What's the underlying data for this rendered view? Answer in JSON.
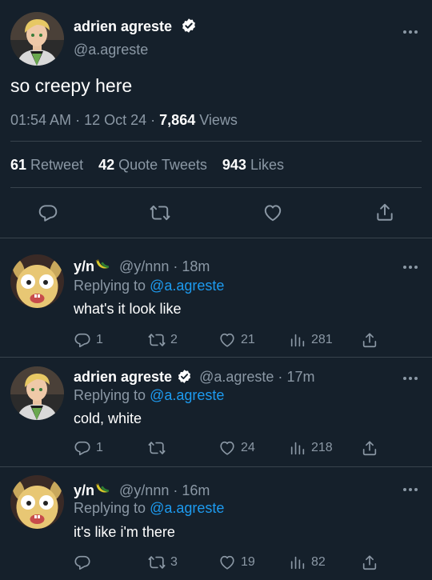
{
  "main_tweet": {
    "name": "adrien agreste",
    "handle": "@a.agreste",
    "text": "so creepy here",
    "time": "01:54 AM",
    "date": "12 Oct 24",
    "views_count": "7,864",
    "views_label": "Views",
    "retweets_count": "61",
    "retweets_label": "Retweet",
    "quotes_count": "42",
    "quotes_label": "Quote Tweets",
    "likes_count": "943",
    "likes_label": "Likes"
  },
  "replies": [
    {
      "name": "y/n",
      "handle": "@y/nnn",
      "age": "18m",
      "replying_prefix": "Replying to",
      "replying_to": "@a.agreste",
      "text": "what's it look like",
      "replies": "1",
      "retweets": "2",
      "likes": "21",
      "views": "281"
    },
    {
      "name": "adrien agreste",
      "handle": "@a.agreste",
      "age": "17m",
      "replying_prefix": "Replying to",
      "replying_to": "@a.agreste",
      "text": "cold, white",
      "replies": "1",
      "retweets": "",
      "likes": "24",
      "views": "218"
    },
    {
      "name": "y/n",
      "handle": "@y/nnn",
      "age": "16m",
      "replying_prefix": "Replying to",
      "replying_to": "@a.agreste",
      "text": "it's like i'm there",
      "replies": "",
      "retweets": "3",
      "likes": "19",
      "views": "82"
    }
  ],
  "separator": "·",
  "colors": {
    "background": "#15202b",
    "muted": "#8b98a5",
    "link": "#1d9bf0",
    "divider": "#38444d"
  },
  "icons": [
    "verified-icon",
    "more-icon",
    "reply-icon",
    "retweet-icon",
    "like-icon",
    "views-icon",
    "share-icon",
    "banana-emoji-icon"
  ]
}
